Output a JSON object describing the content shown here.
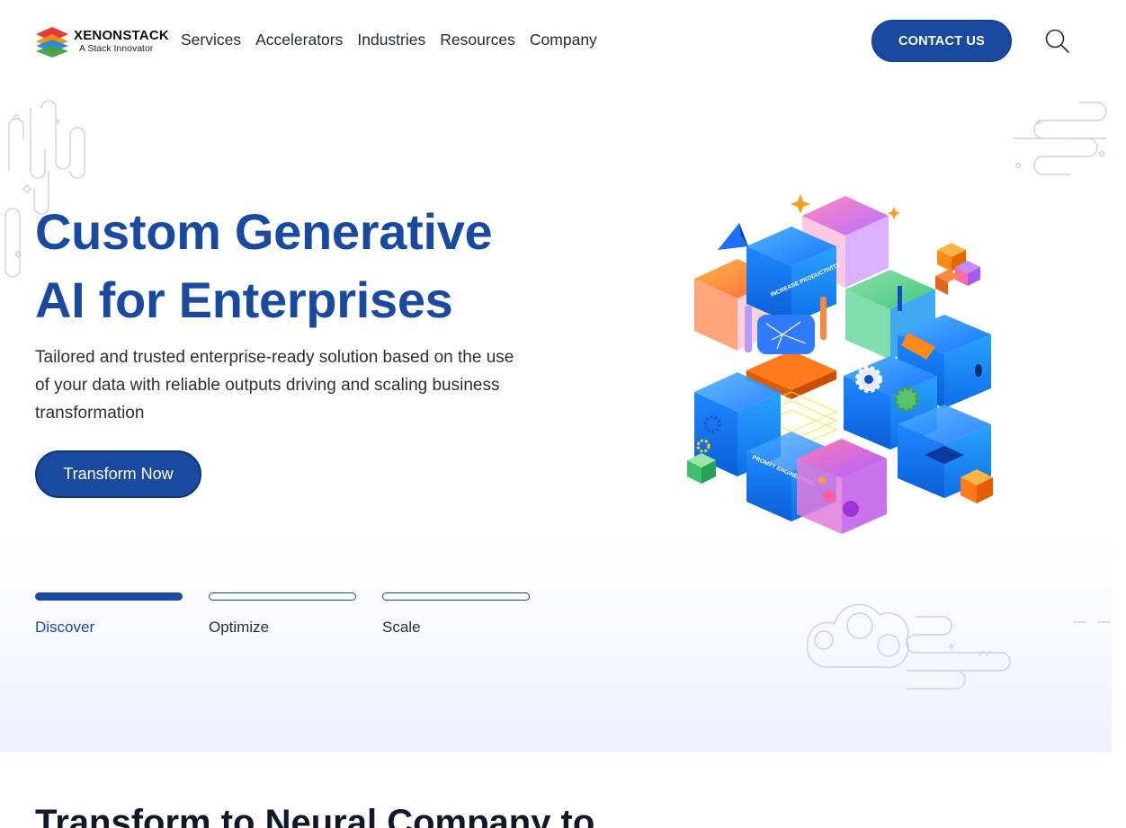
{
  "brand": {
    "name": "XENONSTACK",
    "tagline": "A Stack Innovator"
  },
  "nav": {
    "items": [
      {
        "label": "Services"
      },
      {
        "label": "Accelerators"
      },
      {
        "label": "Industries"
      },
      {
        "label": "Resources"
      },
      {
        "label": "Company"
      }
    ],
    "contact_label": "CONTACT US",
    "search_icon": "search-icon"
  },
  "hero": {
    "title_line1": "Custom Generative",
    "title_line2": "AI for Enterprises",
    "subtitle": "Tailored and trusted enterprise-ready solution based on the use of your data with reliable outputs driving and scaling business transformation",
    "cta_label": "Transform Now",
    "steps": [
      {
        "label": "Discover",
        "active": true
      },
      {
        "label": "Optimize",
        "active": false
      },
      {
        "label": "Scale",
        "active": false
      }
    ],
    "illustration_labels": {
      "productivity": "INCREASE PRODUCTIVITY",
      "prompt": "PROMPT ENGINEERING"
    }
  },
  "section": {
    "title": "Transform to Neural Company to"
  },
  "colors": {
    "primary": "#1a4aa0",
    "text": "#1f2937",
    "hero_gradient_end": "#eef1fb"
  }
}
